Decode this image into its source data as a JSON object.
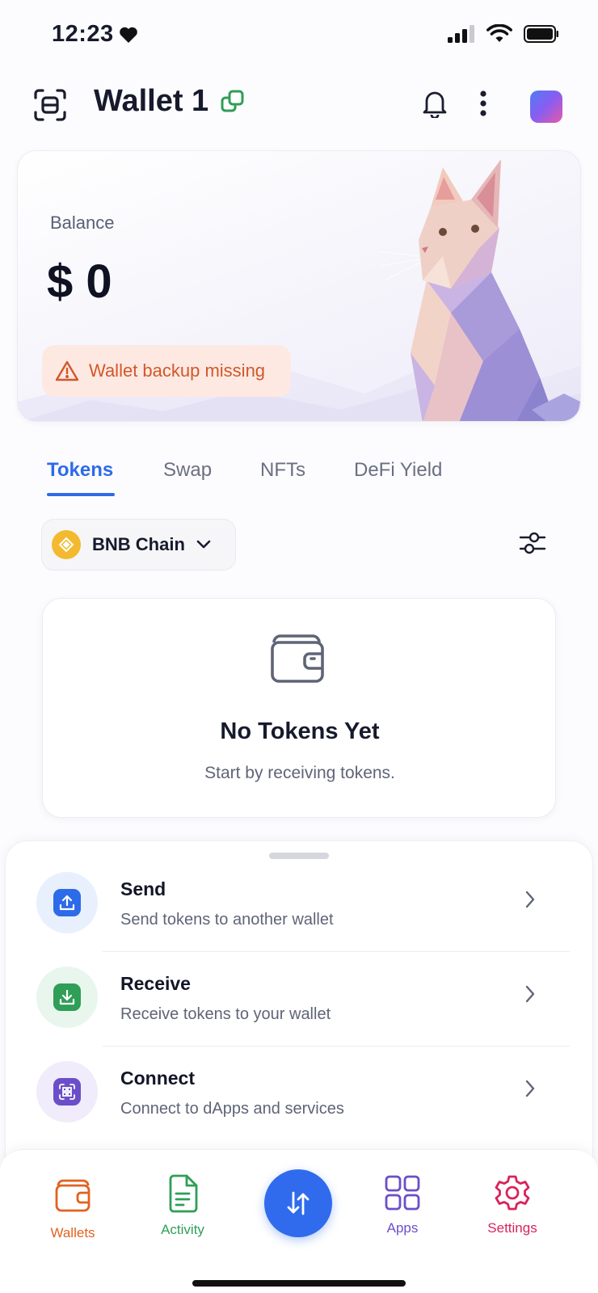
{
  "status_bar": {
    "time": "12:23"
  },
  "header": {
    "title": "Wallet 1"
  },
  "balance": {
    "label": "Balance",
    "value": "$ 0",
    "warning": "Wallet backup missing"
  },
  "tabs": [
    {
      "label": "Tokens",
      "active": true
    },
    {
      "label": "Swap",
      "active": false
    },
    {
      "label": "NFTs",
      "active": false
    },
    {
      "label": "DeFi Yield",
      "active": false
    }
  ],
  "chain": {
    "selected": "BNB Chain"
  },
  "empty_state": {
    "title": "No Tokens Yet",
    "subtitle": "Start by receiving tokens."
  },
  "actions": [
    {
      "title": "Send",
      "subtitle": "Send tokens to another wallet",
      "icon": "upload-icon",
      "color": "#2d6be8"
    },
    {
      "title": "Receive",
      "subtitle": "Receive tokens to your wallet",
      "icon": "download-icon",
      "color": "#2f9e57"
    },
    {
      "title": "Connect",
      "subtitle": "Connect to dApps and services",
      "icon": "qr-scan-icon",
      "color": "#6b4fc8"
    }
  ],
  "bottom_nav": [
    {
      "label": "Wallets",
      "icon": "wallet-icon",
      "color": "#e2621f"
    },
    {
      "label": "Activity",
      "icon": "document-icon",
      "color": "#2f9e57"
    },
    {
      "label": "",
      "icon": "swap-arrows-icon",
      "color": "#2f6bec"
    },
    {
      "label": "Apps",
      "icon": "grid-icon",
      "color": "#6b4fc8"
    },
    {
      "label": "Settings",
      "icon": "gear-icon",
      "color": "#d8245c"
    }
  ]
}
